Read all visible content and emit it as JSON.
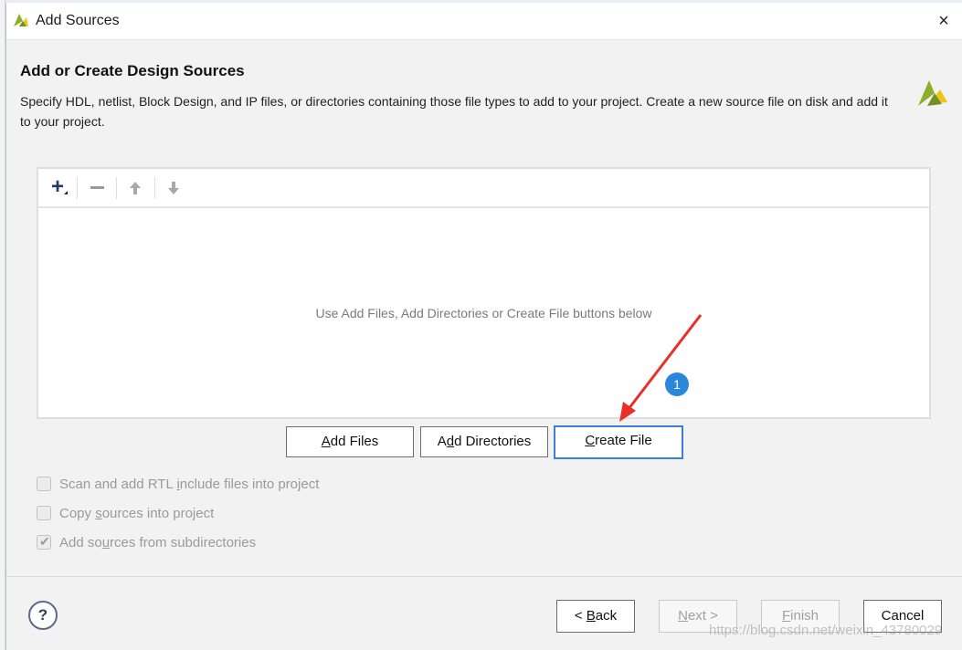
{
  "window": {
    "title": "Add Sources",
    "close_icon": "×"
  },
  "header": {
    "heading": "Add or Create Design Sources",
    "description": "Specify HDL, netlist, Block Design, and IP files, or directories containing those file types to add to your project. Create a new source file on disk and add it to your project."
  },
  "toolbar": {
    "add_icon": "+",
    "remove_icon": "−",
    "move_up_icon": "arrow-up",
    "move_down_icon": "arrow-down"
  },
  "file_list": {
    "empty_message": "Use Add Files, Add Directories or Create File buttons below"
  },
  "action_buttons": {
    "add_files": {
      "mnemonic": "A",
      "rest": "dd Files"
    },
    "add_directories": {
      "before": "A",
      "mnemonic": "d",
      "rest": "d Directories"
    },
    "create_file": {
      "mnemonic": "C",
      "rest": "reate File"
    }
  },
  "options": [
    {
      "before": "Scan and add RTL ",
      "mnemonic": "i",
      "after": "nclude files into project",
      "checked": false
    },
    {
      "before": "Copy ",
      "mnemonic": "s",
      "after": "ources into project",
      "checked": false
    },
    {
      "before": "Add so",
      "mnemonic": "u",
      "after": "rces from subdirectories",
      "checked": true
    }
  ],
  "footer": {
    "help": "?",
    "back": {
      "before": "< ",
      "mnemonic": "B",
      "after": "ack"
    },
    "next": {
      "mnemonic": "N",
      "after": "ext >"
    },
    "finish": {
      "mnemonic": "F",
      "after": "inish"
    },
    "cancel": "Cancel"
  },
  "annotation": {
    "badge": "1",
    "color": "#e8302a"
  },
  "watermark": "https://blog.csdn.net/weixin_43780029",
  "colors": {
    "accent_blue": "#3e7fd6",
    "badge_blue": "#2b87da",
    "logo_green": "#8dae2a",
    "logo_yellow": "#f0c419"
  }
}
